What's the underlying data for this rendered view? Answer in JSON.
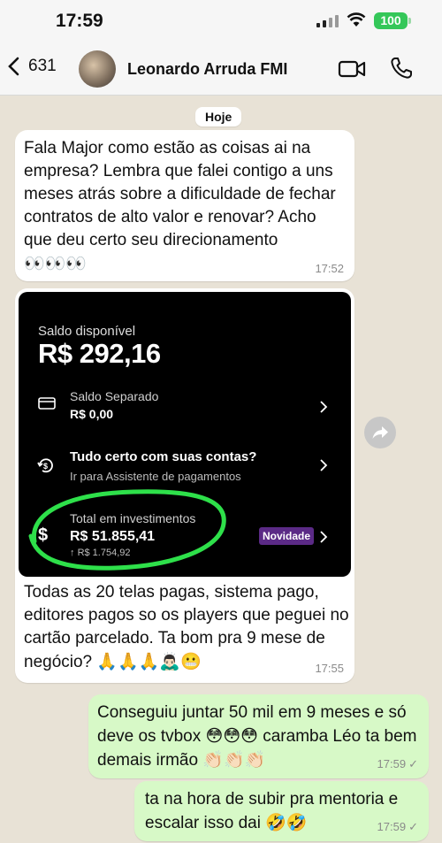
{
  "status_bar": {
    "time": "17:59",
    "battery": "100"
  },
  "header": {
    "back_count": "631",
    "contact_name": "Leonardo Arruda FMI"
  },
  "day_chip": "Hoje",
  "messages": [
    {
      "direction": "in",
      "text": "Fala Major como estão as coisas ai na empresa? Lembra que falei contigo a uns meses atrás sobre a dificuldade de fechar contratos de alto valor e renovar? Acho que deu certo seu direcionamento",
      "emojis": "👀👀👀",
      "time": "17:52"
    },
    {
      "direction": "in",
      "text": "Todas as 20 telas pagas, sistema pago, editores pagos so os players que peguei no cartão parcelado. Ta bom pra 9 mese de negócio?",
      "emojis": "🙏🙏🙏🙇🏻‍♂️😬",
      "time": "17:55",
      "image": {
        "balance_label": "Saldo disponível",
        "balance_value": "R$ 292,16",
        "rows": [
          {
            "title": "Saldo Separado",
            "value": "R$ 0,00",
            "icon": "wallet-icon"
          },
          {
            "title": "Tudo certo com suas contas?",
            "subtitle": "Ir para Assistente de pagamentos",
            "icon": "refresh-dollar-icon"
          },
          {
            "title": "Total em investimentos",
            "value": "R$ 51.855,41",
            "change": "R$ 1.754,92",
            "badge": "Novidade",
            "icon": "dollar-icon"
          }
        ]
      }
    },
    {
      "direction": "out",
      "text": "Conseguiu juntar 50 mil em 9 meses e só deve os tvbox",
      "emojis_mid": "😳😳😳",
      "text_after": "caramba Léo ta bem demais irmão",
      "emojis": "👏🏻👏🏻👏🏻",
      "time": "17:59"
    },
    {
      "direction": "out",
      "text": "ta na hora de subir pra mentoria e escalar isso dai",
      "emojis": "🤣🤣",
      "time": "17:59"
    }
  ],
  "colors": {
    "incoming": "#ffffff",
    "outgoing": "#d7f9c7",
    "background": "#e8e2d6",
    "battery": "#34c759",
    "badge": "#5b2a86",
    "highlight": "#2ee04a"
  }
}
